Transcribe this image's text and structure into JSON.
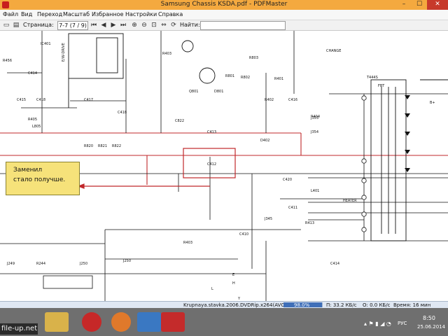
{
  "window": {
    "title": "Samsung Chassis KSDA.pdf - PDFMaster"
  },
  "menu": [
    "Файл",
    "Вид",
    "Переход",
    "Масштаб",
    "Избранное",
    "Настройки",
    "Справка"
  ],
  "toolbar": {
    "page_label": "Страница:",
    "page_value": "7-7  (7 / 9)",
    "find_label": "Найти:",
    "find_value": ""
  },
  "annotation": {
    "line1": "Заменил",
    "line2": "стало получше."
  },
  "schematic": {
    "labels": [
      "IC401",
      "E/W-DRIVE",
      "R456",
      "C414",
      "C415",
      "C418",
      "R405",
      "L805",
      "C417",
      "Q801",
      "R801",
      "R802",
      "R803",
      "R403",
      "D801",
      "R401",
      "R402",
      "C416",
      "C418",
      "R404",
      "C412",
      "C413",
      "R820",
      "R821",
      "R822",
      "C822",
      "C420",
      "D402",
      "C411",
      "C410",
      "T444S",
      "FBT",
      "R403",
      "J249",
      "R244",
      "J250",
      "C414",
      "R413",
      "L401",
      "HEATER",
      "B+",
      "E",
      "H",
      "L",
      "Y",
      "J345",
      "J353",
      "J354",
      "J250",
      "CHANGE"
    ]
  },
  "player": {
    "file": "Krupnaya.stavka.2006.DVDRip.x264(AVC)",
    "progress_pct": 98.0,
    "progress_text": "98.0%",
    "speed_down": "П: 33.2 КБ/с",
    "speed_up": "О: 0.0 КБ/с",
    "remaining": "Время: 16 мин"
  },
  "taskbar": {
    "lang": "РУС",
    "time": "8:50",
    "date": "25.06.2014",
    "watermark": "file-up.net"
  },
  "colors": {
    "titlebar": "#f4a93f",
    "schematic_red": "#c0282b",
    "annotation_bg": "#f6e27a",
    "progress": "#3f6fb8"
  }
}
